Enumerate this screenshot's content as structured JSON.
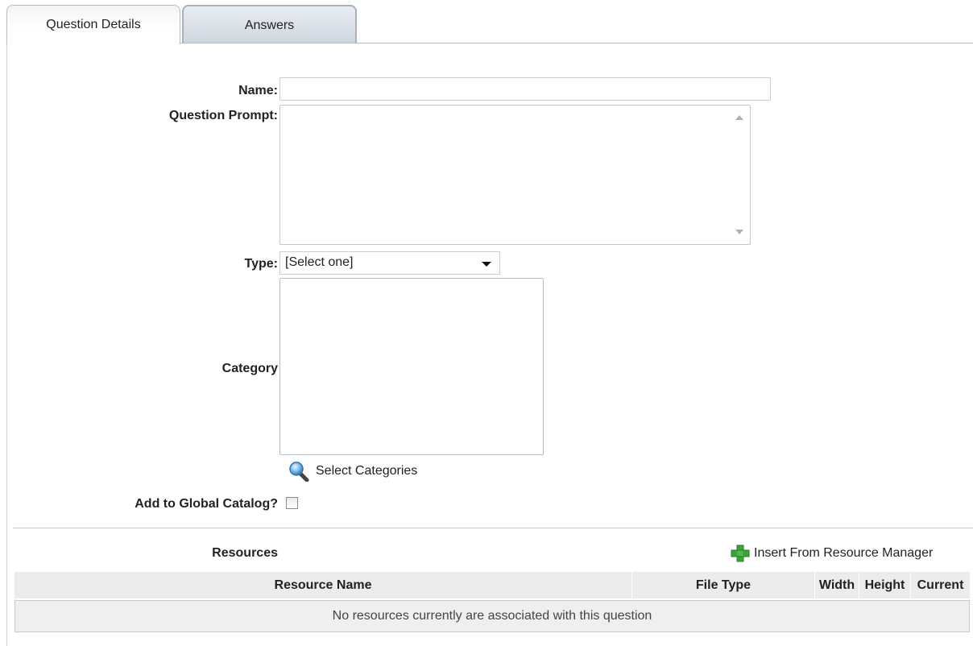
{
  "tabs": [
    {
      "label": "Question Details",
      "active": true
    },
    {
      "label": "Answers",
      "active": false
    }
  ],
  "form": {
    "name_label": "Name:",
    "name_value": "",
    "prompt_label": "Question Prompt:",
    "prompt_value": "",
    "type_label": "Type:",
    "type_selected": "[Select one]",
    "category_label": "Category",
    "select_categories": "Select Categories",
    "global_catalog_label": "Add to Global Catalog?",
    "global_catalog_checked": false
  },
  "resources": {
    "title": "Resources",
    "insert_label": "Insert From Resource Manager",
    "columns": [
      "Resource Name",
      "File Type",
      "Width",
      "Height",
      "Current"
    ],
    "empty_message": "No resources currently are associated with this question"
  },
  "icons": {
    "search": "magnifier-icon",
    "insert": "green-plus-icon"
  },
  "colors": {
    "plus_green": "#3aa43a",
    "tab_inactive": "#d6dce4"
  }
}
